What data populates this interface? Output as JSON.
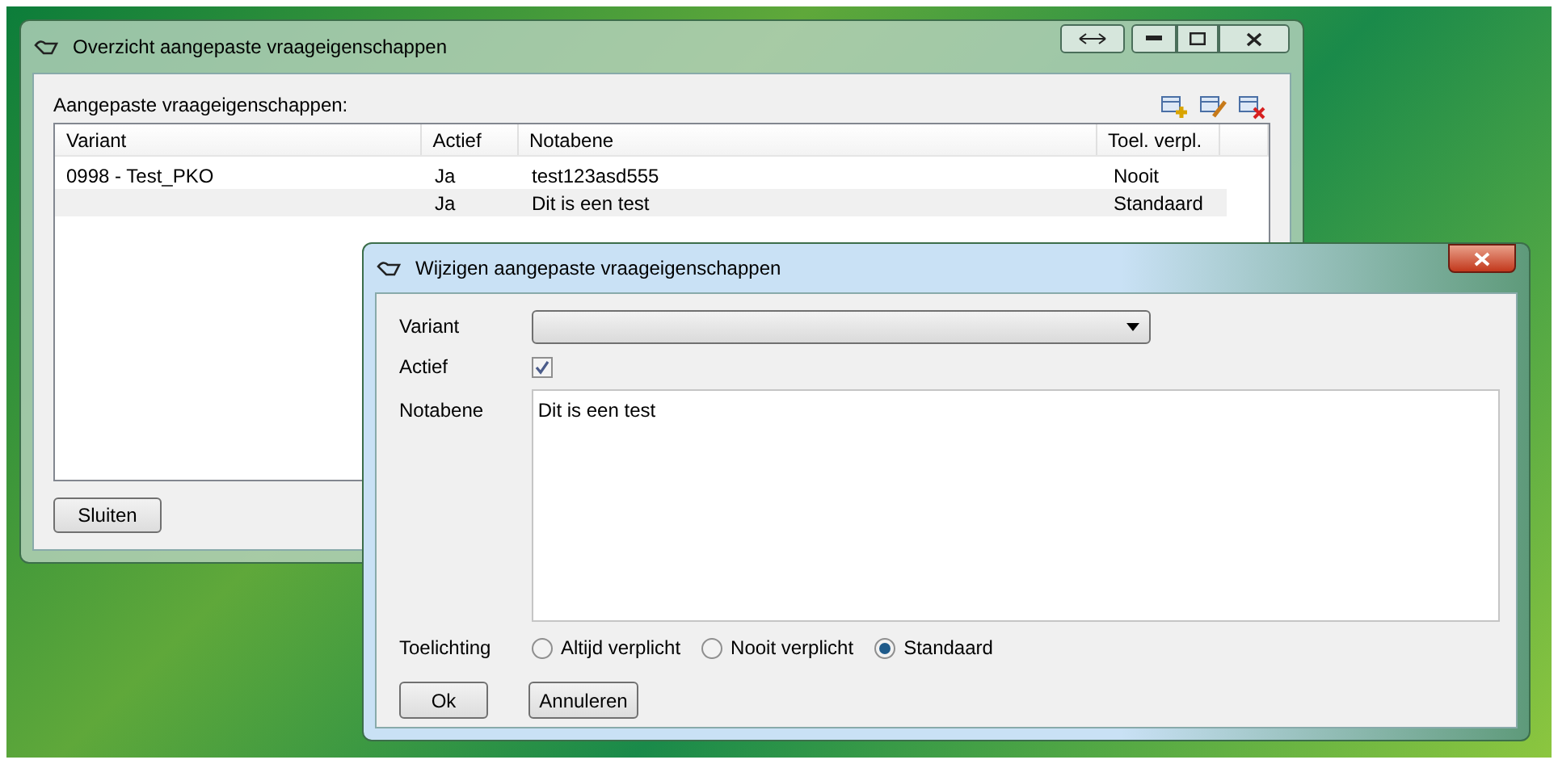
{
  "main_window": {
    "title": "Overzicht aangepaste vraageigenschappen",
    "list_label": "Aangepaste vraageigenschappen:",
    "table": {
      "columns": [
        "Variant",
        "Actief",
        "Notabene",
        "Toel. verpl."
      ],
      "rows": [
        {
          "cells": [
            "0998 - Test_PKO",
            "Ja",
            "test123asd555",
            "Nooit"
          ],
          "selected": false
        },
        {
          "cells": [
            "",
            "Ja",
            "Dit is een test",
            "Standaard"
          ],
          "selected": true
        }
      ]
    },
    "close_button": "Sluiten"
  },
  "dialog": {
    "title": "Wijzigen aangepaste vraageigenschappen",
    "variant_label": "Variant",
    "active_label": "Actief",
    "active_checked": true,
    "note_label": "Notabene",
    "note_value": "Dit is een test",
    "explanation_label": "Toelichting",
    "radios": [
      {
        "label": "Altijd verplicht",
        "selected": false
      },
      {
        "label": "Nooit verplicht",
        "selected": false
      },
      {
        "label": "Standaard",
        "selected": true
      }
    ],
    "buttons": [
      "Ok",
      "Annuleren"
    ]
  }
}
